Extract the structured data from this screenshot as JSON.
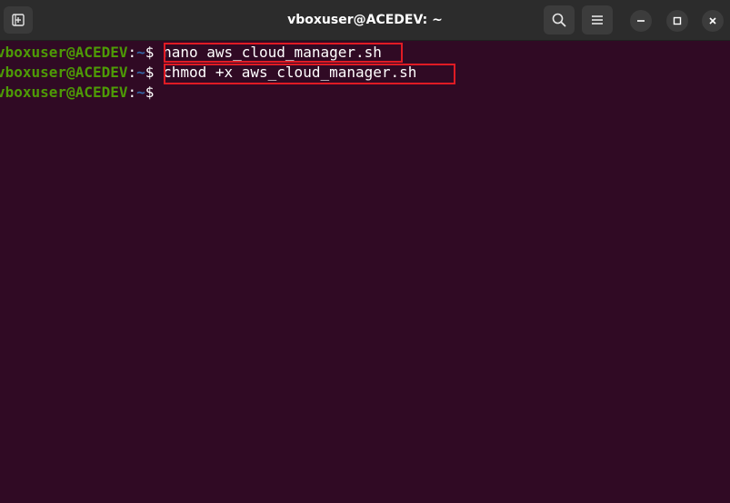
{
  "window": {
    "title": "vboxuser@ACEDEV: ~"
  },
  "headerbar": {
    "new_tab_icon": "new-tab-icon",
    "search_icon": "search-icon",
    "menu_icon": "hamburger-menu-icon",
    "minimize_icon": "minimize-icon",
    "maximize_icon": "maximize-icon",
    "close_icon": "close-icon"
  },
  "terminal": {
    "colors": {
      "background": "#300a24",
      "user_host": "#4e9a06",
      "path": "#3465a4",
      "text": "#ffffff",
      "highlight_box": "#e01b24"
    },
    "lines": [
      {
        "user_host": "vboxuser@ACEDEV",
        "colon": ":",
        "path": "~",
        "prompt": "$",
        "command": "nano aws_cloud_manager.sh",
        "highlighted": true
      },
      {
        "user_host": "vboxuser@ACEDEV",
        "colon": ":",
        "path": "~",
        "prompt": "$",
        "command": "chmod +x aws_cloud_manager.sh",
        "highlighted": true
      },
      {
        "user_host": "vboxuser@ACEDEV",
        "colon": ":",
        "path": "~",
        "prompt": "$",
        "command": "",
        "highlighted": false
      }
    ]
  }
}
